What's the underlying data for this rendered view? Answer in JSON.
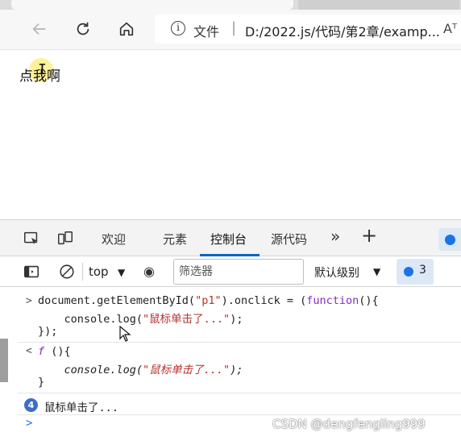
{
  "browser": {
    "address": {
      "label": "文件",
      "separator": "|",
      "url": "D:/2022.js/代码/第2章/examp...",
      "read_aloud": "Aᵀ"
    }
  },
  "page": {
    "text": "点我啊"
  },
  "devtools": {
    "tabs": [
      "欢迎",
      "元素",
      "控制台",
      "源代码"
    ],
    "active_tab": "控制台",
    "more": "»",
    "add": "+",
    "context": "top",
    "filter_placeholder": "筛选器",
    "level": "默认级别",
    "issues_count": "3"
  },
  "console": {
    "input_line1_a": "document.getElementById(",
    "input_line1_str": "\"p1\"",
    "input_line1_b": ").onclick = (",
    "input_line1_kw": "function",
    "input_line1_c": "(){",
    "input_line2_a": "    console.log(",
    "input_line2_str": "\"鼠标单击了...\"",
    "input_line2_b": ");",
    "input_line3": "});",
    "result_f": "f",
    "result_line1": " (){",
    "result_line2_a": "    console.log(",
    "result_line2_str": "\"鼠标单击了...\"",
    "result_line2_b": ");",
    "result_line3": "}",
    "log_repeat": "4",
    "log_message": "鼠标单击了...",
    "input_prompt": ">",
    "output_prompt": "<"
  },
  "watermark": "CSDN @dengfengling999"
}
